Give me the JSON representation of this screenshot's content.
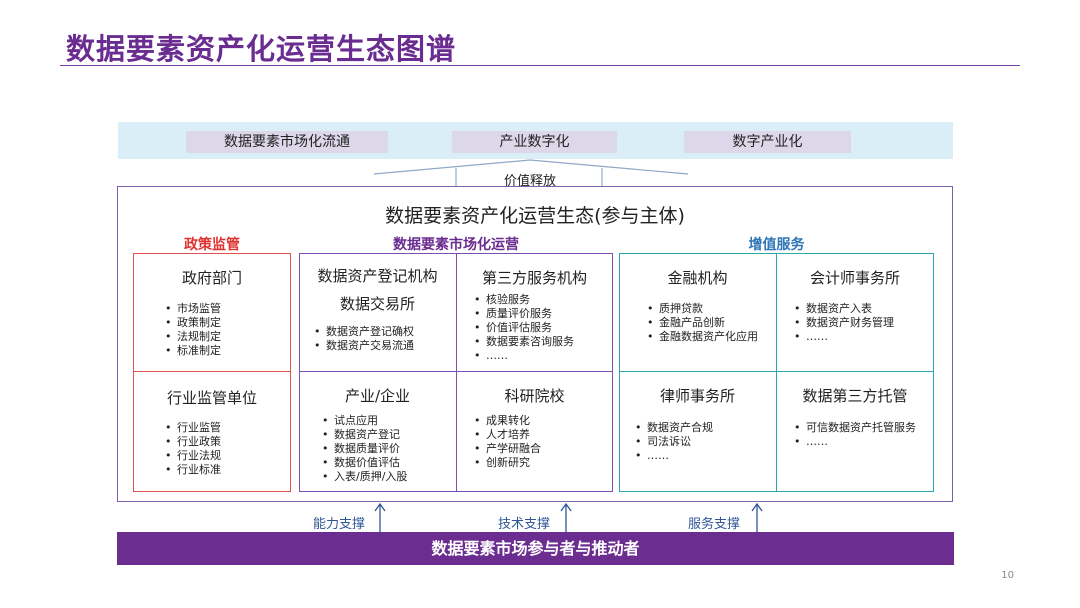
{
  "page": {
    "title": "数据要素资产化运营生态图谱",
    "page_number": "10"
  },
  "top": {
    "tags": [
      "数据要素市场化流通",
      "产业数字化",
      "数字产业化"
    ],
    "value_label": "价值释放"
  },
  "ecosystem": {
    "title": "数据要素资产化运营生态(参与主体)"
  },
  "sections": {
    "policy": "政策监管",
    "market": "数据要素市场化运营",
    "value_added": "增值服务"
  },
  "cells": [
    {
      "title": "政府部门",
      "items": [
        "市场监管",
        "政策制定",
        "法规制定",
        "标准制定"
      ]
    },
    {
      "title": "行业监管单位",
      "items": [
        "行业监管",
        "行业政策",
        "行业法规",
        "行业标准"
      ]
    },
    {
      "title": "数据资产登记机构",
      "title2": "数据交易所",
      "items": [
        "数据资产登记确权",
        "数据资产交易流通"
      ]
    },
    {
      "title": "产业/企业",
      "items": [
        "试点应用",
        "数据资产登记",
        "数据质量评价",
        "数据价值评估",
        "入表/质押/入股"
      ]
    },
    {
      "title": "第三方服务机构",
      "items": [
        "核验服务",
        "质量评价服务",
        "价值评估服务",
        "数据要素咨询服务",
        "……"
      ]
    },
    {
      "title": "科研院校",
      "items": [
        "成果转化",
        "人才培养",
        "产学研融合",
        "创新研究"
      ]
    },
    {
      "title": "金融机构",
      "items": [
        "质押贷款",
        "金融产品创新",
        "金融数据资产化应用"
      ]
    },
    {
      "title": "律师事务所",
      "items": [
        "数据资产合规",
        "司法诉讼",
        "……"
      ]
    },
    {
      "title": "会计师事务所",
      "items": [
        "数据资产入表",
        "数据资产财务管理",
        "……"
      ]
    },
    {
      "title": "数据第三方托管",
      "items": [
        "可信数据资产托管服务",
        "……"
      ]
    }
  ],
  "supports": [
    "能力支撑",
    "技术支撑",
    "服务支撑"
  ],
  "bottom": {
    "label": "数据要素市场参与者与推动者"
  },
  "colors": {
    "brand": "#6b2e90",
    "policy": "#e03030",
    "market": "#6a2c91",
    "value_added": "#2e75b6",
    "teal": "#2aa7b0",
    "top_band": "#d9eef6"
  }
}
